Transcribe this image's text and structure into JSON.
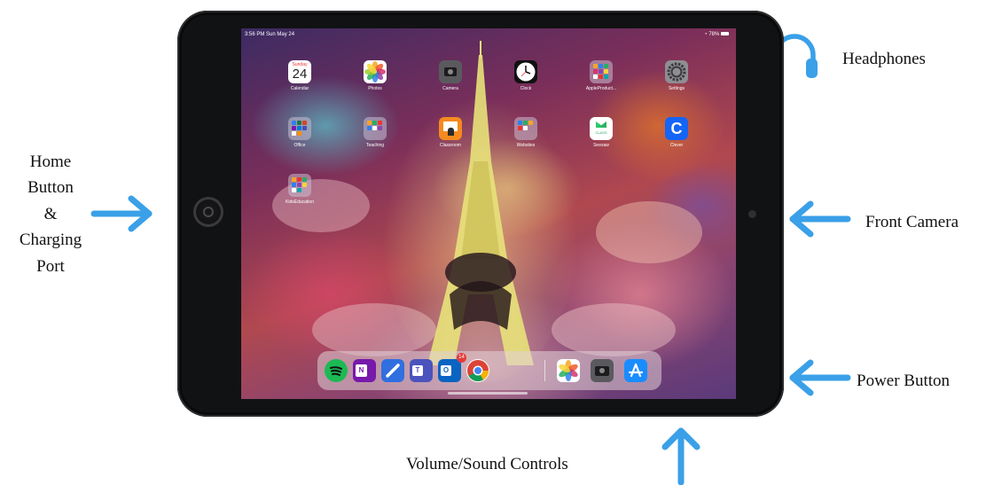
{
  "labels": {
    "headphones": "Headphones",
    "home_button": [
      "Home",
      "Button",
      "&",
      "Charging",
      "Port"
    ],
    "front_camera": "Front Camera",
    "power_button": "Power Button",
    "volume": "Volume/Sound Controls"
  },
  "colors": {
    "arrow": "#3aa0e8",
    "device": "#111214"
  },
  "statusbar": {
    "time_date": "3:56 PM  Sun May 24",
    "battery": "78%"
  },
  "apps": [
    {
      "name": "Calendar",
      "icon": "calendar-icon",
      "day": "Sunday",
      "date": "24"
    },
    {
      "name": "Photos",
      "icon": "photos-icon"
    },
    {
      "name": "Camera",
      "icon": "camera-icon"
    },
    {
      "name": "Clock",
      "icon": "clock-icon"
    },
    {
      "name": "AppleProduct...",
      "icon": "folder-icon"
    },
    {
      "name": "Settings",
      "icon": "gear-icon"
    },
    {
      "name": "Office",
      "icon": "folder-icon"
    },
    {
      "name": "Teaching",
      "icon": "folder-icon"
    },
    {
      "name": "Classroom",
      "icon": "classroom-icon"
    },
    {
      "name": "Websites",
      "icon": "folder-icon"
    },
    {
      "name": "Seesaw",
      "icon": "seesaw-icon",
      "text": "CLASS"
    },
    {
      "name": "Clever",
      "icon": "clever-icon",
      "text": "C"
    },
    {
      "name": "KidsEducation",
      "icon": "folder-icon"
    }
  ],
  "dock": {
    "apps": [
      "spotify-icon",
      "onenote-icon",
      "pencil-app-icon",
      "teams-icon",
      "outlook-icon",
      "chrome-icon",
      "photos-icon",
      "camera-icon",
      "app-store-icon"
    ],
    "outlook_badge": "14"
  }
}
